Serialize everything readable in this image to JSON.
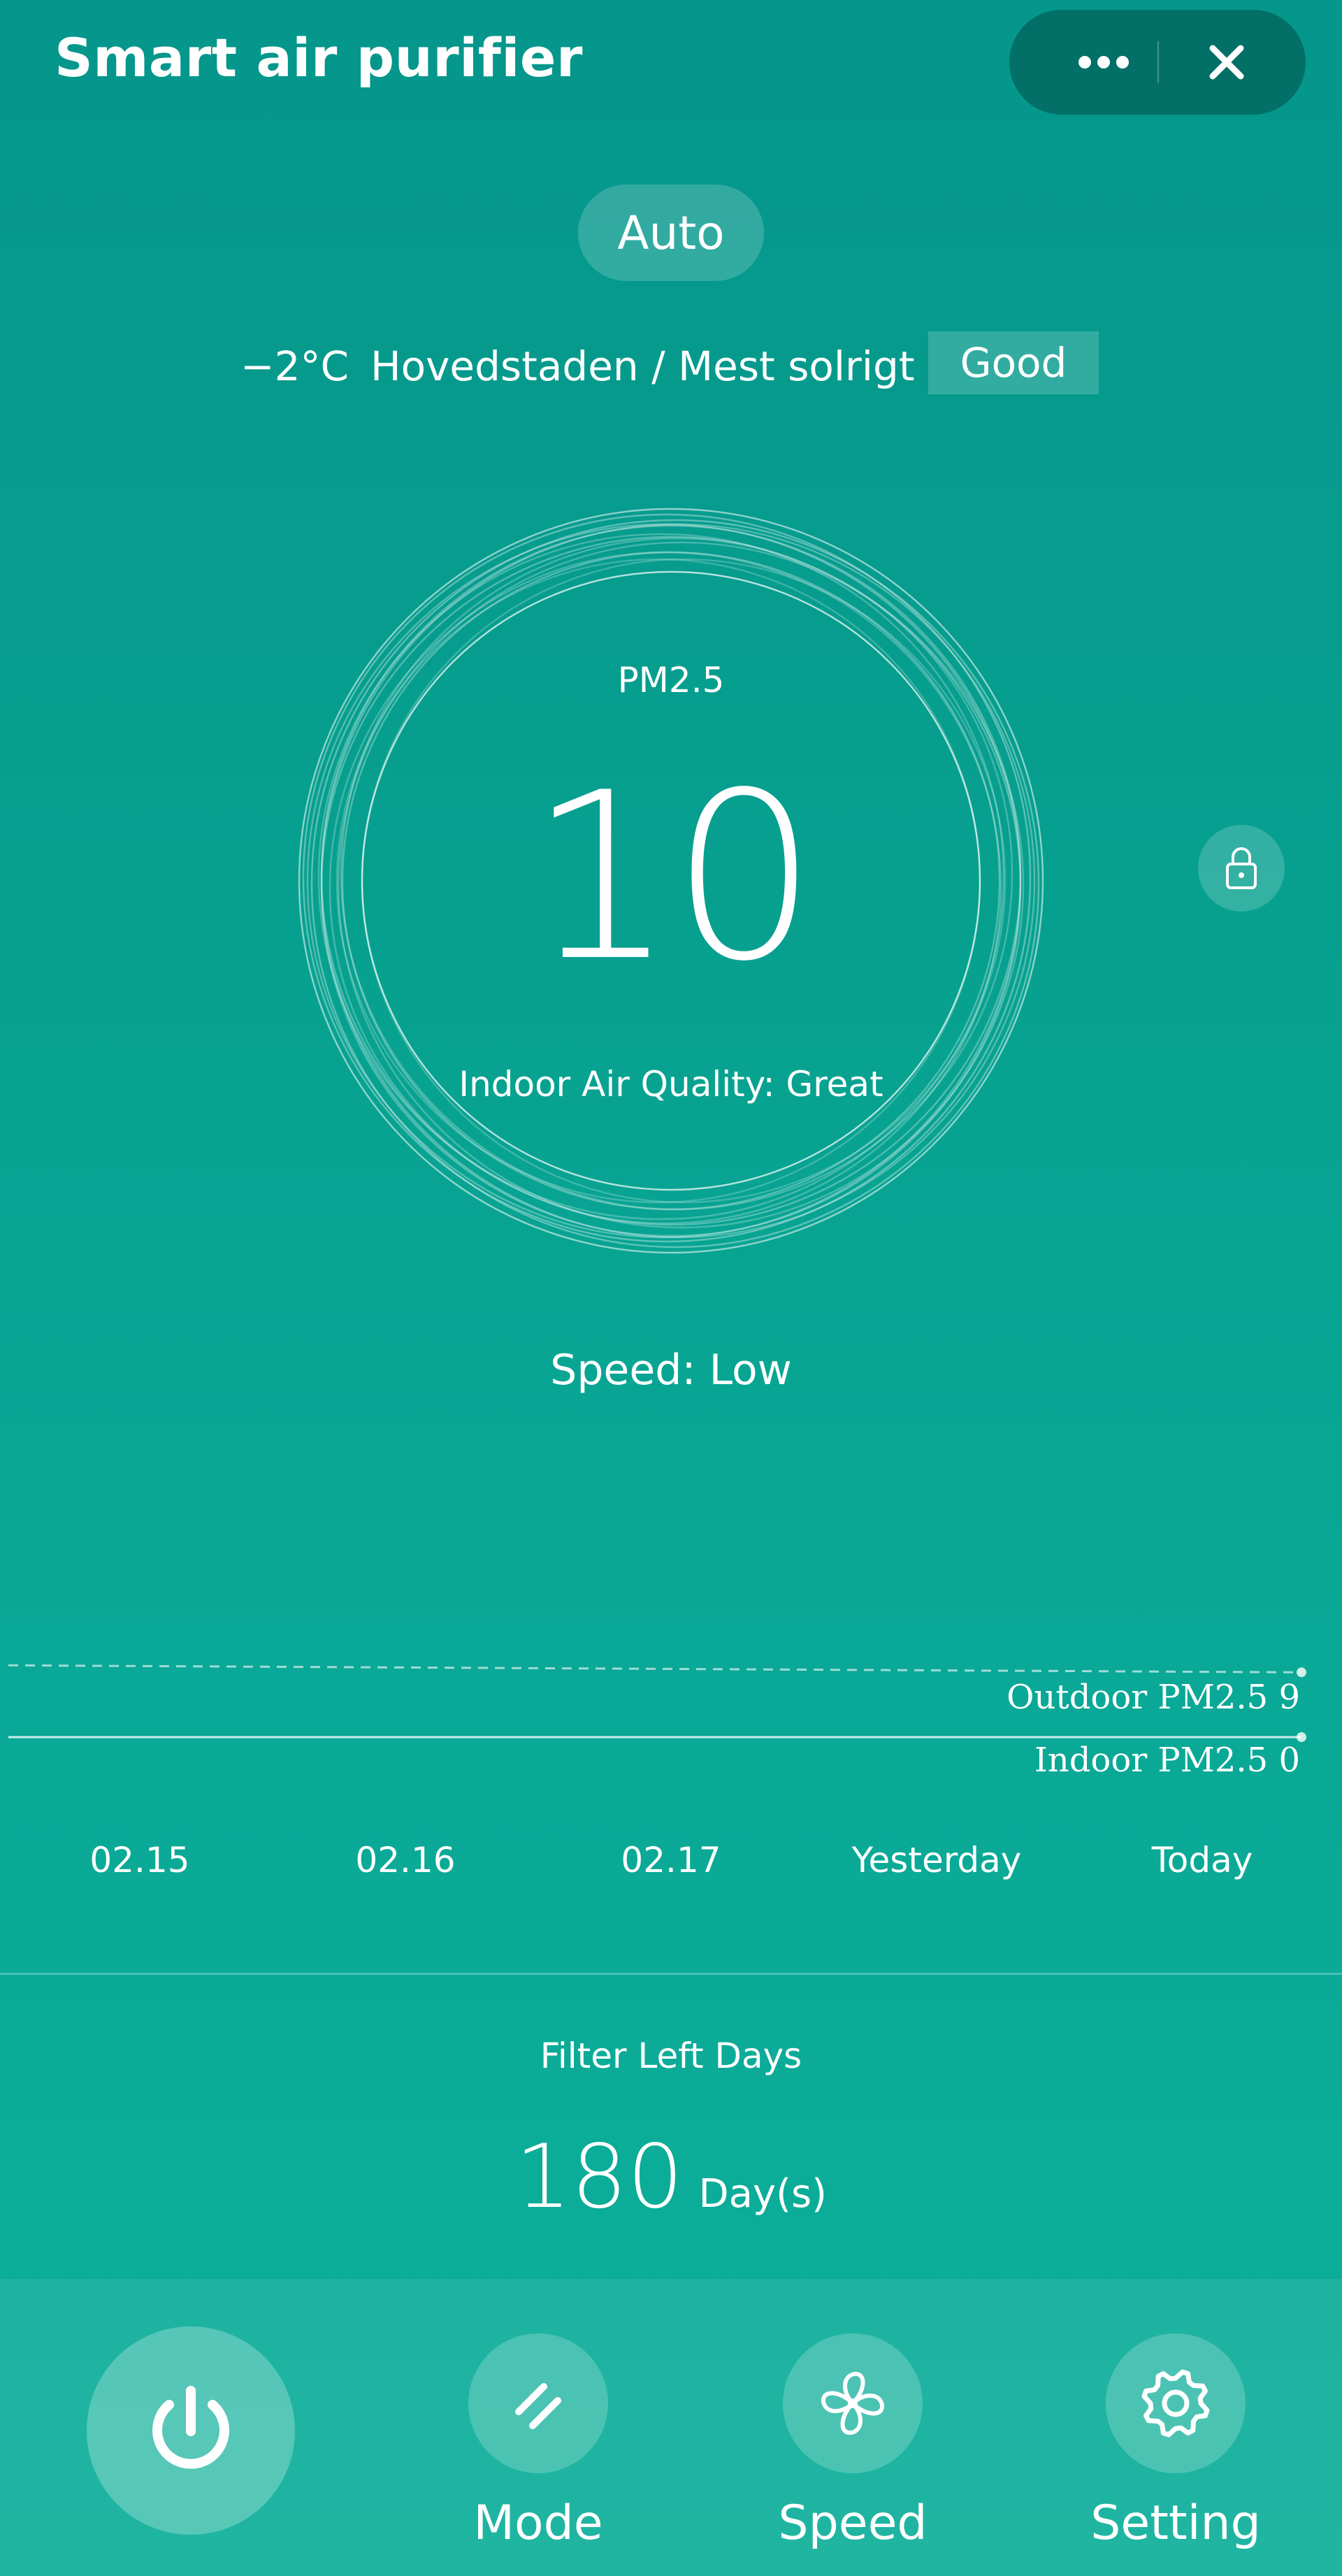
{
  "header": {
    "title": "Smart air purifier",
    "more_icon": "more-dots-icon",
    "close_icon": "close-icon"
  },
  "mode_pill": "Auto",
  "weather": {
    "temperature": "−2°C",
    "location": "Hovedstaden / Mest solrigt",
    "air_badge": "Good"
  },
  "dial": {
    "label": "PM2.5",
    "value": "10",
    "quality": "Indoor Air Quality: Great"
  },
  "lock_icon": "lock-icon",
  "speed_status": "Speed: Low",
  "chart_data": {
    "type": "line",
    "categories": [
      "02.15",
      "02.16",
      "02.17",
      "Yesterday",
      "Today"
    ],
    "series": [
      {
        "name": "Outdoor PM2.5",
        "label": "Outdoor PM2.5 9",
        "values": [
          null,
          null,
          null,
          null,
          9
        ],
        "style": "dashed"
      },
      {
        "name": "Indoor PM2.5",
        "label": "Indoor PM2.5 0",
        "values": [
          null,
          null,
          null,
          null,
          0
        ],
        "style": "solid"
      }
    ],
    "grid": false
  },
  "filter": {
    "label": "Filter Left Days",
    "value": "180",
    "unit": "Day(s)"
  },
  "bottom_bar": {
    "power_icon": "power-icon",
    "mode_label": "Mode",
    "speed_label": "Speed",
    "setting_label": "Setting"
  },
  "colors": {
    "bg_top": "#05968c",
    "bg_bottom": "#0caf9a",
    "text": "#ffffff"
  }
}
